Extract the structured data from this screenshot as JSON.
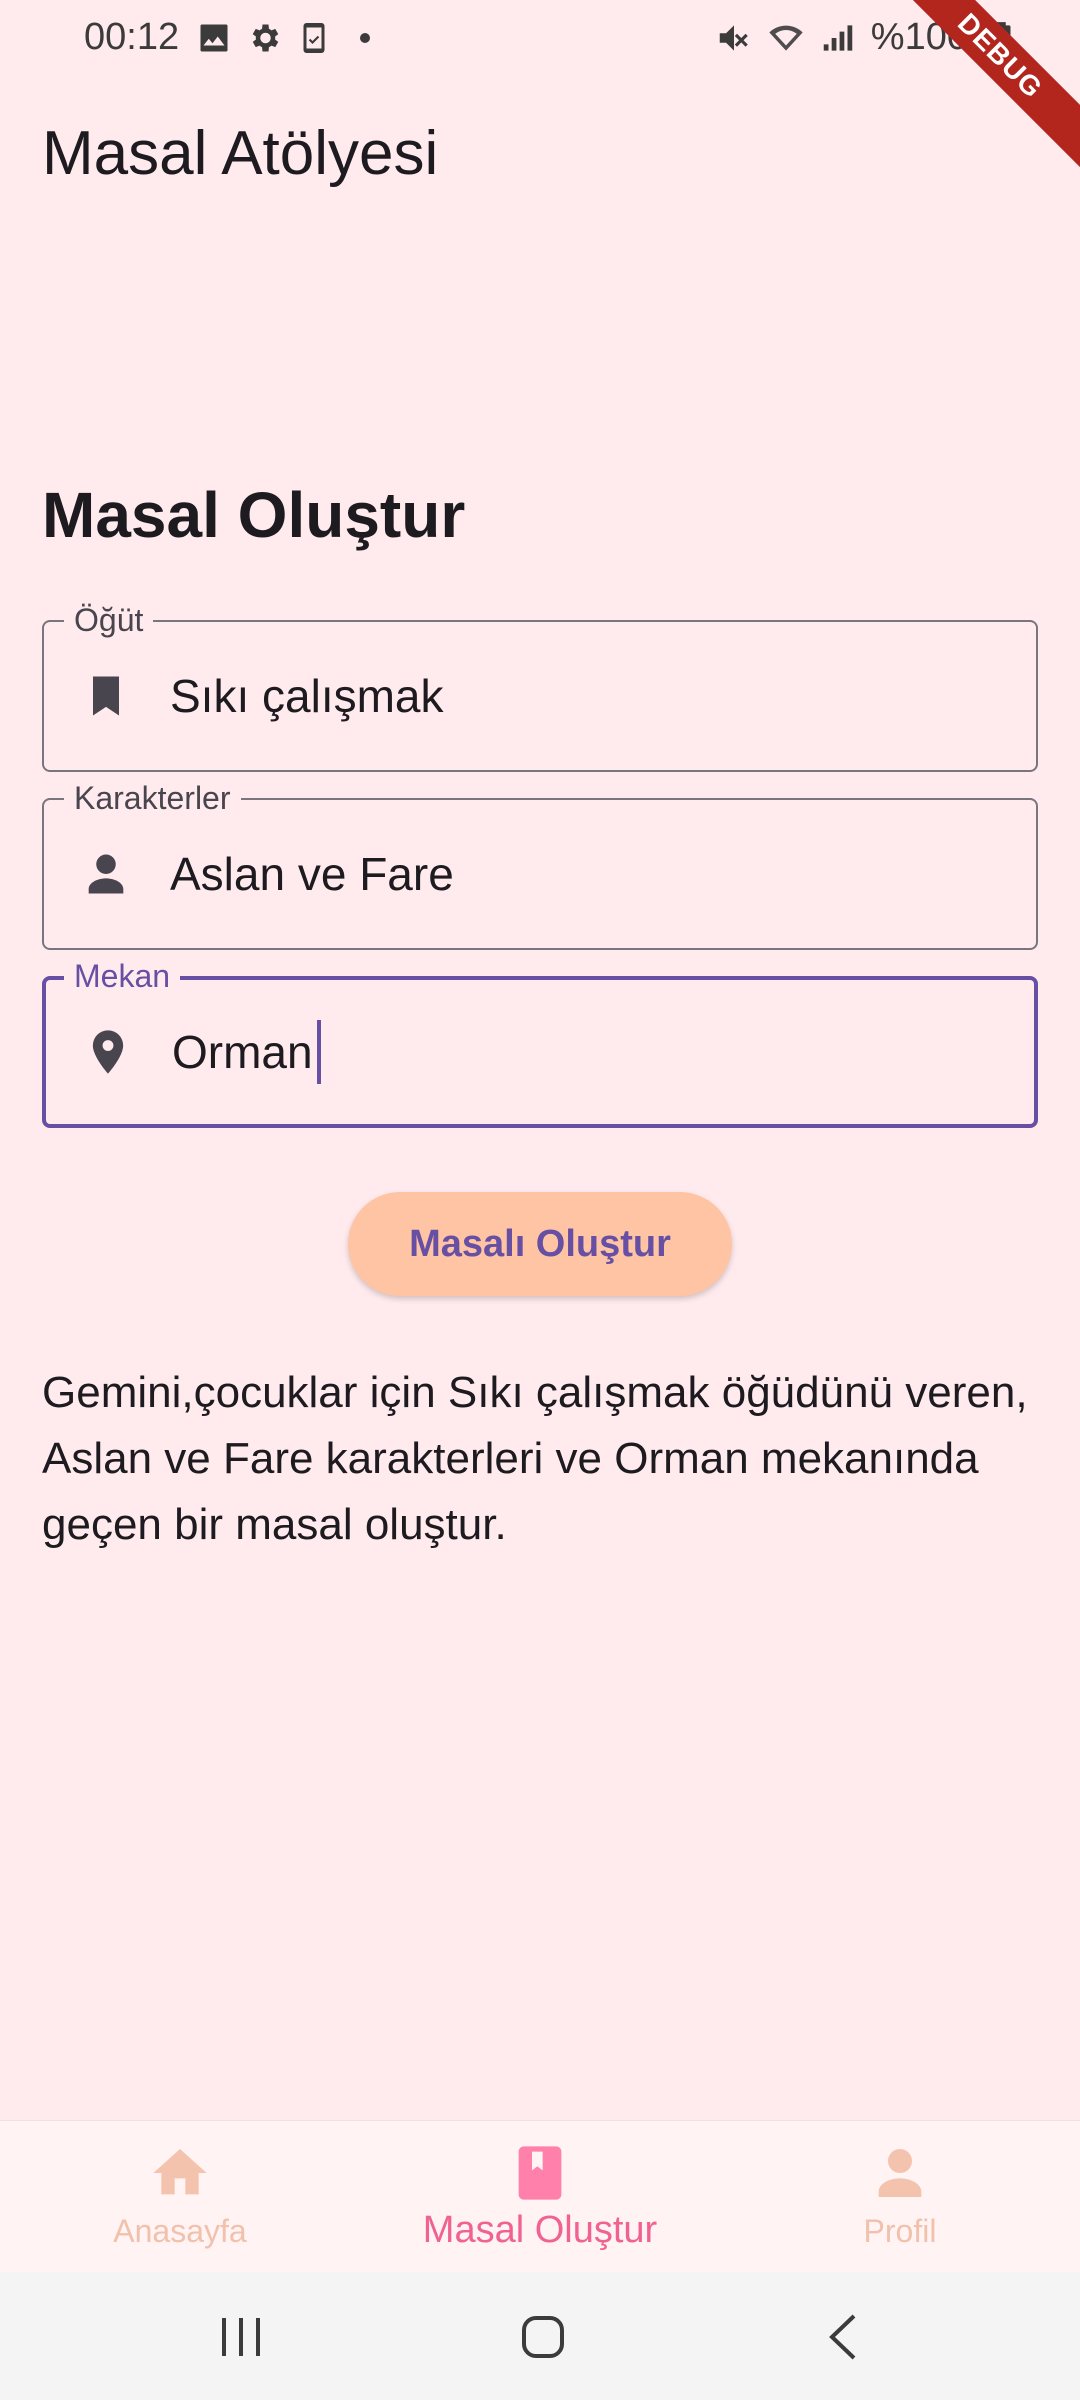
{
  "status_bar": {
    "time": "00:12",
    "battery": "%100"
  },
  "debug_banner": "DEBUG",
  "app_bar": {
    "title": "Masal Atölyesi"
  },
  "form": {
    "title": "Masal Oluştur",
    "fields": [
      {
        "label": "Öğüt",
        "value": "Sıkı çalışmak",
        "icon": "bookmark-icon"
      },
      {
        "label": "Karakterler",
        "value": "Aslan ve Fare",
        "icon": "person-icon"
      },
      {
        "label": "Mekan",
        "value": "Orman",
        "icon": "location-pin-icon"
      }
    ],
    "button_label": "Masalı Oluştur"
  },
  "prompt_text": "Gemini,çocuklar için Sıkı çalışmak öğüdünü veren, Aslan ve Fare karakterleri ve Orman mekanında geçen bir masal oluştur.",
  "bottom_nav": {
    "items": [
      {
        "label": "Anasayfa",
        "icon": "home-icon",
        "active": false
      },
      {
        "label": "Masal Oluştur",
        "icon": "book-icon",
        "active": true
      },
      {
        "label": "Profil",
        "icon": "person-icon",
        "active": false
      }
    ]
  },
  "colors": {
    "background": "#FFEBEE",
    "primary": "#6750A4",
    "button_bg": "#FFC4A3",
    "nav_active": "#F06292",
    "nav_inactive": "#F1C1AC"
  }
}
